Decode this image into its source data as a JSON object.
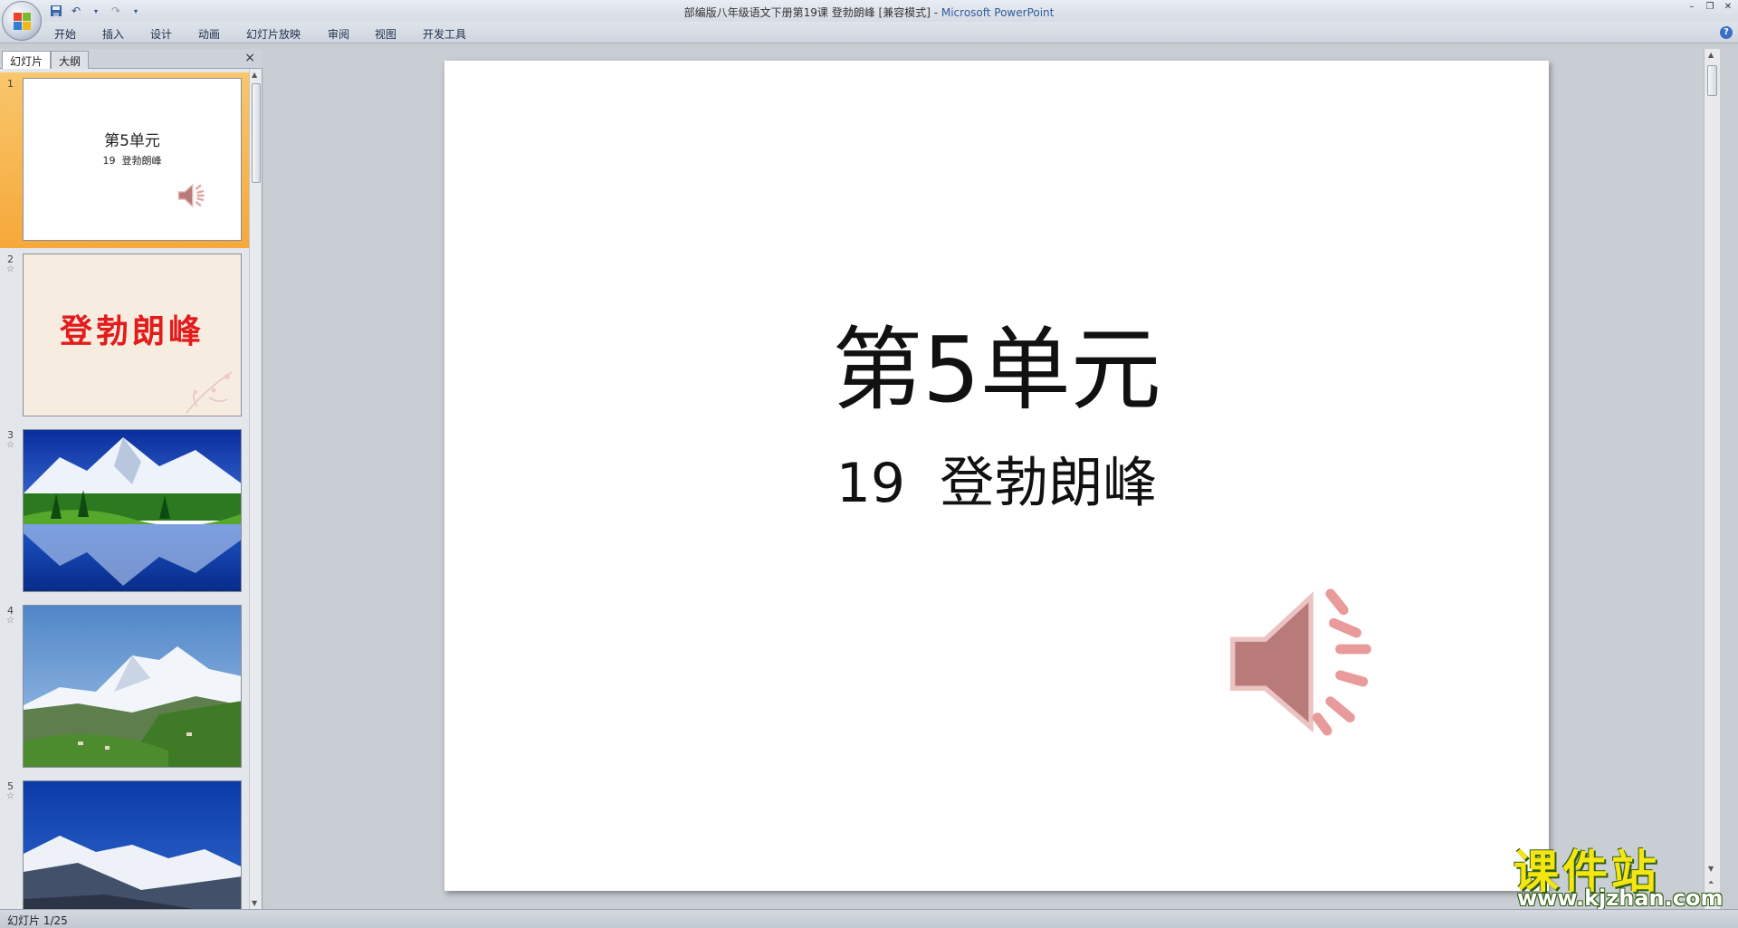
{
  "window": {
    "doc_title": "部编版八年级语文下册第19课 登勃朗峰 [兼容模式]",
    "separator": " - ",
    "app_name": "Microsoft PowerPoint"
  },
  "ribbon": {
    "tabs": [
      "开始",
      "插入",
      "设计",
      "动画",
      "幻灯片放映",
      "审阅",
      "视图",
      "开发工具"
    ]
  },
  "panel": {
    "tabs": [
      "幻灯片",
      "大纲"
    ],
    "close_glyph": "×"
  },
  "thumbnails": [
    {
      "number": "1",
      "title": "第5单元",
      "subtitle": "19  登勃朗峰",
      "selected": true
    },
    {
      "number": "2",
      "text": "登勃朗峰",
      "text_color": "#e41b1b",
      "bg": "#f6ece0"
    },
    {
      "number": "3"
    },
    {
      "number": "4"
    },
    {
      "number": "5"
    }
  ],
  "slide": {
    "title": "第5单元",
    "subtitle": "19  登勃朗峰",
    "speaker_icon": "speaker-icon",
    "speaker_color": "#b97a7a"
  },
  "status": {
    "slide_counter": "幻灯片 1/25"
  },
  "watermark": {
    "text": "课件站",
    "url": "www.kjzhan.com"
  },
  "colors": {
    "selected_thumb": "#f6a83a",
    "title_app": "#2f5b9b"
  }
}
